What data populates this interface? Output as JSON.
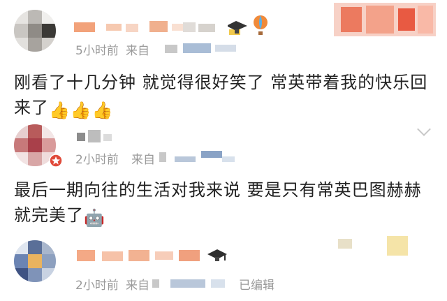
{
  "comments": [
    {
      "time": "5小时前",
      "source_prefix": "来自",
      "text_line1": "刚看了十几分钟 就觉得很好笑了 常英带着我的快乐回",
      "text_line2": "来了",
      "emojis": [
        "👍",
        "👍",
        "👍"
      ]
    },
    {
      "time": "2小时前",
      "source_prefix": "来自",
      "text_line1": "最后一期向往的生活对我来说 要是只有常英巴图赫赫",
      "text_line2": "就完美了",
      "emojis": [
        "🤖"
      ]
    },
    {
      "time": "2小时前",
      "source_prefix": "来自",
      "edited": "已编辑"
    }
  ],
  "icons": {
    "badge": "graduation-cap-icon",
    "balloon": "hot-air-balloon-icon",
    "verified": "red-star-badge-icon",
    "more": "chevron-down-icon"
  }
}
